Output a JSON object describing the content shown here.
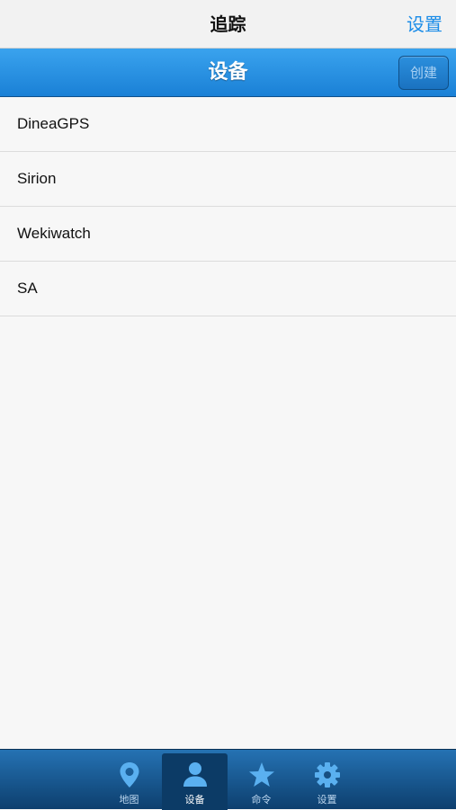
{
  "topbar": {
    "title": "追踪",
    "settings_label": "设置"
  },
  "header": {
    "title": "设备",
    "create_label": "创建"
  },
  "devices": [
    {
      "name": "DineaGPS"
    },
    {
      "name": "Sirion"
    },
    {
      "name": "Wekiwatch"
    },
    {
      "name": "SA"
    }
  ],
  "tabs": [
    {
      "label": "地图",
      "icon": "map-pin-icon"
    },
    {
      "label": "设备",
      "icon": "person-icon",
      "active": true
    },
    {
      "label": "命令",
      "icon": "star-icon"
    },
    {
      "label": "设置",
      "icon": "gear-icon"
    }
  ],
  "colors": {
    "accent": "#1a8ce8",
    "header_blue": "#2a92e4",
    "tabbar_blue": "#1a5a94",
    "tab_icon": "#5ab0f0"
  }
}
